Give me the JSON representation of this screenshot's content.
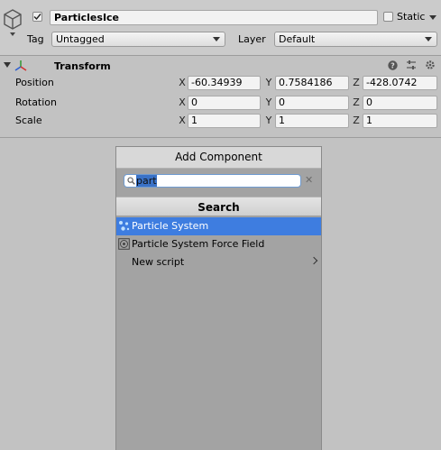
{
  "header": {
    "object_name": "ParticlesIce",
    "active_checked": true,
    "static_label": "Static",
    "tag_label": "Tag",
    "tag_value": "Untagged",
    "layer_label": "Layer",
    "layer_value": "Default"
  },
  "transform": {
    "title": "Transform",
    "rows": [
      {
        "label": "Position",
        "x": "-60.34939",
        "y": "0.7584186",
        "z": "-428.0742"
      },
      {
        "label": "Rotation",
        "x": "0",
        "y": "0",
        "z": "0"
      },
      {
        "label": "Scale",
        "x": "1",
        "y": "1",
        "z": "1"
      }
    ],
    "axis": {
      "x": "X",
      "y": "Y",
      "z": "Z"
    }
  },
  "add_component": {
    "title": "Add Component",
    "search_value": "part",
    "search_header": "Search",
    "items": [
      {
        "label": "Particle System",
        "selected": true
      },
      {
        "label": "Particle System Force Field",
        "selected": false
      },
      {
        "label": "New script",
        "selected": false
      }
    ]
  },
  "colors": {
    "selection": "#3e7de0",
    "panel": "#c2c2c2",
    "popup": "#a3a3a3"
  }
}
